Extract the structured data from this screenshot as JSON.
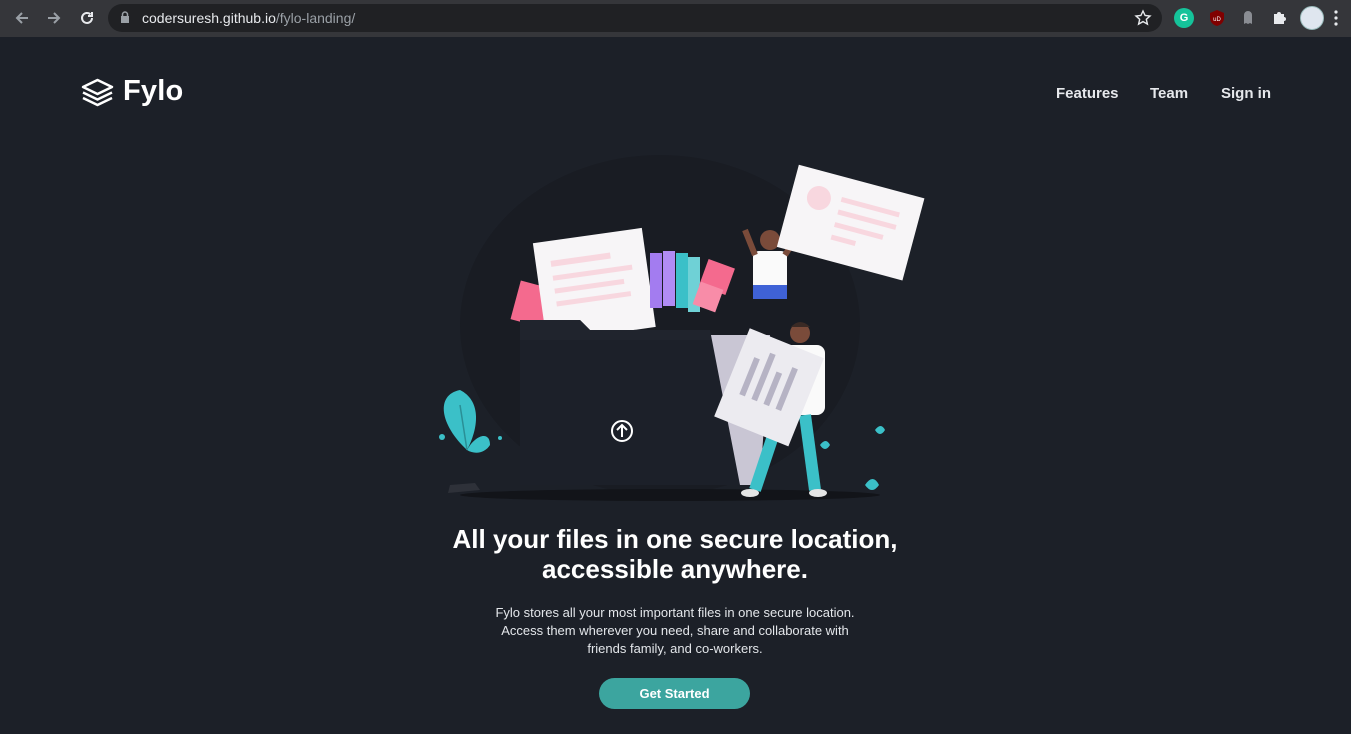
{
  "browser": {
    "url_host": "codersuresh.github.io",
    "url_path": "/fylo-landing/",
    "extensions": [
      "grammarly-icon",
      "ublock-icon",
      "ghostery-icon",
      "puzzle-icon",
      "avatar"
    ],
    "grammarly_letter": "G",
    "ublock_label": "uD"
  },
  "header": {
    "logo_text": "Fylo",
    "nav": [
      "Features",
      "Team",
      "Sign in"
    ]
  },
  "hero": {
    "headline_line1": "All your files in one secure location,",
    "headline_line2": "accessible anywhere.",
    "description_line1": "Fylo stores all your most important files in one secure location.",
    "description_line2": "Access them wherever you need, share and collaborate with",
    "description_line3": "friends family, and co-workers.",
    "cta_label": "Get Started"
  },
  "colors": {
    "background": "#1c2028",
    "accent": "#3ca59f",
    "pink": "#f46a8e",
    "teal": "#3bc0c8"
  }
}
